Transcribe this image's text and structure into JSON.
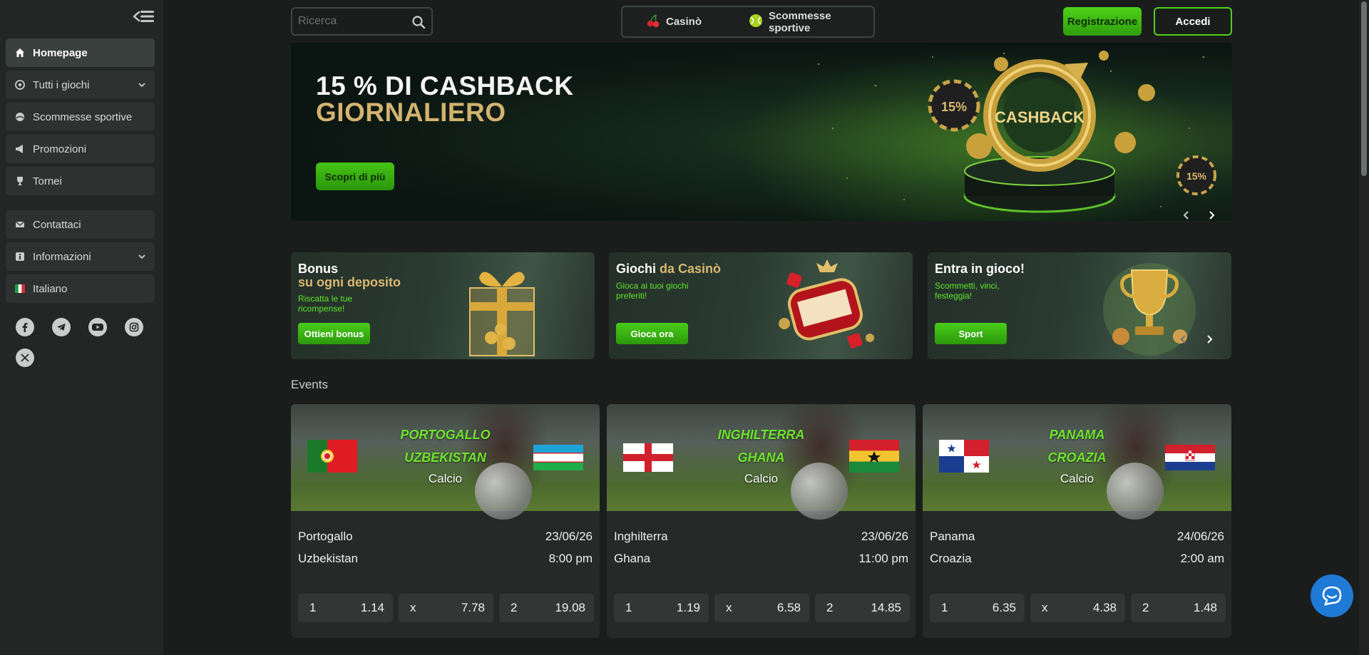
{
  "sidebar": {
    "items": [
      {
        "label": "Homepage",
        "icon": "home-icon"
      },
      {
        "label": "Tutti i giochi",
        "icon": "games-icon"
      },
      {
        "label": "Scommesse sportive",
        "icon": "sports-icon"
      },
      {
        "label": "Promozioni",
        "icon": "megaphone-icon"
      },
      {
        "label": "Tornei",
        "icon": "trophy-icon"
      },
      {
        "label": "Contattaci",
        "icon": "mail-icon"
      },
      {
        "label": "Informazioni",
        "icon": "info-icon"
      },
      {
        "label": "Italiano",
        "icon": "italy-flag-icon"
      }
    ],
    "socials": [
      "facebook-icon",
      "telegram-icon",
      "youtube-icon",
      "instagram-icon",
      "x-icon"
    ]
  },
  "header": {
    "search_placeholder": "Ricerca",
    "mode_casino": "Casinò",
    "mode_sports": "Scommesse sportive",
    "register": "Registrazione",
    "login": "Accedi"
  },
  "hero": {
    "title_line1": "15 % DI CASHBACK",
    "title_line2": "GIORNALIERO",
    "button": "Scopri di più",
    "art_text": "CASHBACK",
    "chip_text": "15%"
  },
  "promos": [
    {
      "title_white": "Bonus",
      "title_gold": "su ogni deposito",
      "sub": "Riscatta le tue ricompense!",
      "button": "Ottieni bonus"
    },
    {
      "title_white": "Giochi",
      "title_gold": "da Casinò",
      "sub": "Gioca ai tuoi giochi preferiti!",
      "button": "Gioca ora"
    },
    {
      "title_white": "Entra in gioco!",
      "title_gold": "",
      "sub": "Scommetti, vinci, festeggia!",
      "button": "Sport"
    }
  ],
  "events_title": "Events",
  "events": [
    {
      "team1_banner": "PORTOGALLO",
      "team2_banner": "UZBEKISTAN",
      "sport": "Calcio",
      "team1": "Portogallo",
      "team2": "Uzbekistan",
      "date": "23/06/26",
      "time": "8:00 pm",
      "odds": [
        {
          "label": "1",
          "value": "1.14"
        },
        {
          "label": "x",
          "value": "7.78"
        },
        {
          "label": "2",
          "value": "19.08"
        }
      ]
    },
    {
      "team1_banner": "INGHILTERRA",
      "team2_banner": "GHANA",
      "sport": "Calcio",
      "team1": "Inghilterra",
      "team2": "Ghana",
      "date": "23/06/26",
      "time": "11:00 pm",
      "odds": [
        {
          "label": "1",
          "value": "1.19"
        },
        {
          "label": "x",
          "value": "6.58"
        },
        {
          "label": "2",
          "value": "14.85"
        }
      ]
    },
    {
      "team1_banner": "PANAMA",
      "team2_banner": "CROAZIA",
      "sport": "Calcio",
      "team1": "Panama",
      "team2": "Croazia",
      "date": "24/06/26",
      "time": "2:00 am",
      "odds": [
        {
          "label": "1",
          "value": "6.35"
        },
        {
          "label": "x",
          "value": "4.38"
        },
        {
          "label": "2",
          "value": "1.48"
        }
      ]
    }
  ],
  "colors": {
    "accent": "#4ed418",
    "gold": "#d2b36e",
    "background": "#1a1d1c",
    "sidebar": "#222625"
  }
}
